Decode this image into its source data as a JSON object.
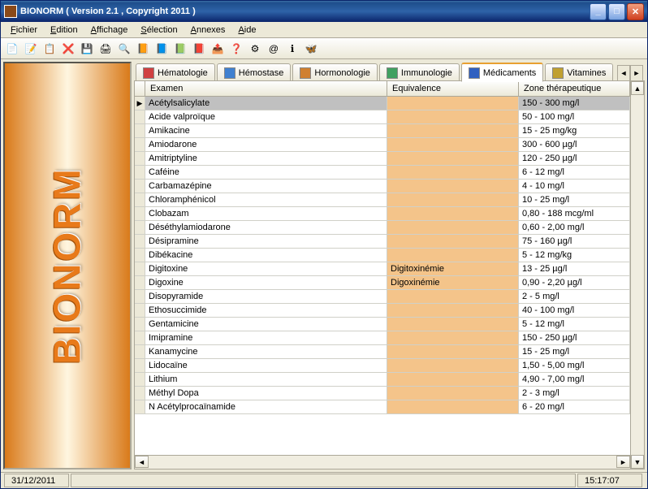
{
  "window": {
    "title": "BIONORM ( Version 2.1 , Copyright 2011 )"
  },
  "menu": {
    "items": [
      "Fichier",
      "Edition",
      "Affichage",
      "Sélection",
      "Annexes",
      "Aide"
    ]
  },
  "tabs": [
    {
      "label": "Hématologie",
      "active": false
    },
    {
      "label": "Hémostase",
      "active": false
    },
    {
      "label": "Hormonologie",
      "active": false
    },
    {
      "label": "Immunologie",
      "active": false
    },
    {
      "label": "Médicaments",
      "active": true
    },
    {
      "label": "Vitamines",
      "active": false
    }
  ],
  "columns": {
    "exam": "Examen",
    "equiv": "Equivalence",
    "zone": "Zone thérapeutique"
  },
  "rows": [
    {
      "exam": "Acétylsalicylate",
      "equiv": "",
      "zone": "150 - 300 mg/l",
      "selected": true
    },
    {
      "exam": "Acide valproïque",
      "equiv": "",
      "zone": "50 - 100 mg/l"
    },
    {
      "exam": "Amikacine",
      "equiv": "",
      "zone": "15 - 25 mg/kg"
    },
    {
      "exam": "Amiodarone",
      "equiv": "",
      "zone": "300 - 600 µg/l"
    },
    {
      "exam": "Amitriptyline",
      "equiv": "",
      "zone": "120 - 250 µg/l"
    },
    {
      "exam": "Caféine",
      "equiv": "",
      "zone": "6 - 12 mg/l"
    },
    {
      "exam": "Carbamazépine",
      "equiv": "",
      "zone": "4 - 10 mg/l"
    },
    {
      "exam": "Chloramphénicol",
      "equiv": "",
      "zone": "10 - 25 mg/l"
    },
    {
      "exam": "Clobazam",
      "equiv": "",
      "zone": "0,80 - 188 mcg/ml"
    },
    {
      "exam": "Déséthylamiodarone",
      "equiv": "",
      "zone": "0,60 - 2,00 mg/l"
    },
    {
      "exam": "Désipramine",
      "equiv": "",
      "zone": "75 - 160 µg/l"
    },
    {
      "exam": "Dibékacine",
      "equiv": "",
      "zone": "5 - 12 mg/kg"
    },
    {
      "exam": "Digitoxine",
      "equiv": "Digitoxinémie",
      "zone": "13 - 25 µg/l"
    },
    {
      "exam": "Digoxine",
      "equiv": "Digoxinémie",
      "zone": "0,90 - 2,20 µg/l"
    },
    {
      "exam": "Disopyramide",
      "equiv": "",
      "zone": "2 - 5 mg/l"
    },
    {
      "exam": "Ethosuccimide",
      "equiv": "",
      "zone": "40 - 100 mg/l"
    },
    {
      "exam": "Gentamicine",
      "equiv": "",
      "zone": "5 - 12 mg/l"
    },
    {
      "exam": "Imipramine",
      "equiv": "",
      "zone": "150 - 250 µg/l"
    },
    {
      "exam": "Kanamycine",
      "equiv": "",
      "zone": "15 - 25 mg/l"
    },
    {
      "exam": "Lidocaïne",
      "equiv": "",
      "zone": "1,50 - 5,00 mg/l"
    },
    {
      "exam": "Lithium",
      "equiv": "",
      "zone": "4,90 - 7,00 mg/l"
    },
    {
      "exam": "Méthyl Dopa",
      "equiv": "",
      "zone": "2 - 3 mg/l"
    },
    {
      "exam": "N Acétylprocaïnamide",
      "equiv": "",
      "zone": "6 - 20 mg/l"
    }
  ],
  "sidebar": {
    "brand": "BIONORM"
  },
  "status": {
    "date": "31/12/2011",
    "time": "15:17:07"
  }
}
